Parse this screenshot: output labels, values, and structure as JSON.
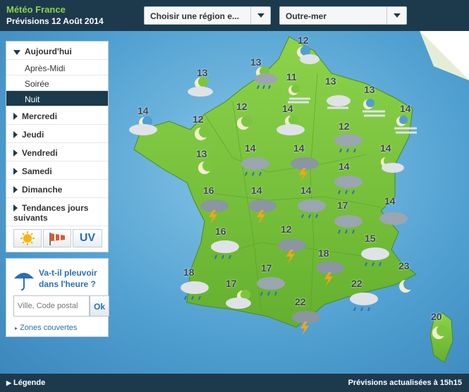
{
  "header": {
    "brand": "Météo France",
    "subtitle": "Prévisions 12 Août 2014",
    "region_select": "Choisir une région e...",
    "outremer_select": "Outre-mer"
  },
  "menu": {
    "today": "Aujourd'hui",
    "apresmidi": "Après-Midi",
    "soiree": "Soirée",
    "nuit": "Nuit",
    "mercredi": "Mercredi",
    "jeudi": "Jeudi",
    "vendredi": "Vendredi",
    "samedi": "Samedi",
    "dimanche": "Dimanche",
    "tendances": "Tendances jours suivants",
    "uv": "UV"
  },
  "rain": {
    "question": "Va-t-il pleuvoir dans l'heure ?",
    "placeholder": "Ville, Code postal",
    "ok": "Ok",
    "zones": "Zones couvertes"
  },
  "footer": {
    "legende": "Légende",
    "updated": "Prévisions actualisées à 15h15"
  },
  "colors": {
    "dark": "#1d3a4d",
    "green": "#7cc63f",
    "accent": "#8fd34a",
    "sea": "#4f9fd0"
  },
  "temperatures": [
    "12",
    "13",
    "13",
    "11",
    "13",
    "13",
    "14",
    "14",
    "12",
    "12",
    "14",
    "12",
    "13",
    "14",
    "14",
    "14",
    "14",
    "16",
    "14",
    "14",
    "17",
    "14",
    "16",
    "12",
    "15",
    "18",
    "18",
    "17",
    "17",
    "23",
    "22",
    "22",
    "20"
  ]
}
